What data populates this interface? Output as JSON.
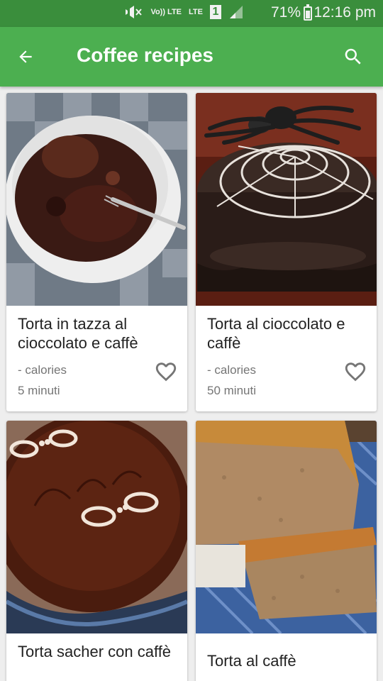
{
  "status_bar": {
    "volte_label": "Vo)) LTE",
    "lte_label": "LTE",
    "sim_slot": "1",
    "battery": "71%",
    "time": "12:16 pm"
  },
  "app_bar": {
    "title": "Coffee recipes",
    "back_icon": "arrow-back-icon",
    "search_icon": "search-icon"
  },
  "recipes": [
    {
      "title": "Torta in tazza al cioccolato e caffè",
      "calories": "- calories",
      "time": "5 minuti"
    },
    {
      "title": "Torta al cioccolato e caffè",
      "calories": "- calories",
      "time": "50 minuti"
    },
    {
      "title": "Torta sacher con caffè"
    },
    {
      "title": "Torta al caffè"
    }
  ],
  "colors": {
    "status_bar": "#3a8e3c",
    "app_bar": "#4caf50",
    "background": "#eeeeee"
  }
}
